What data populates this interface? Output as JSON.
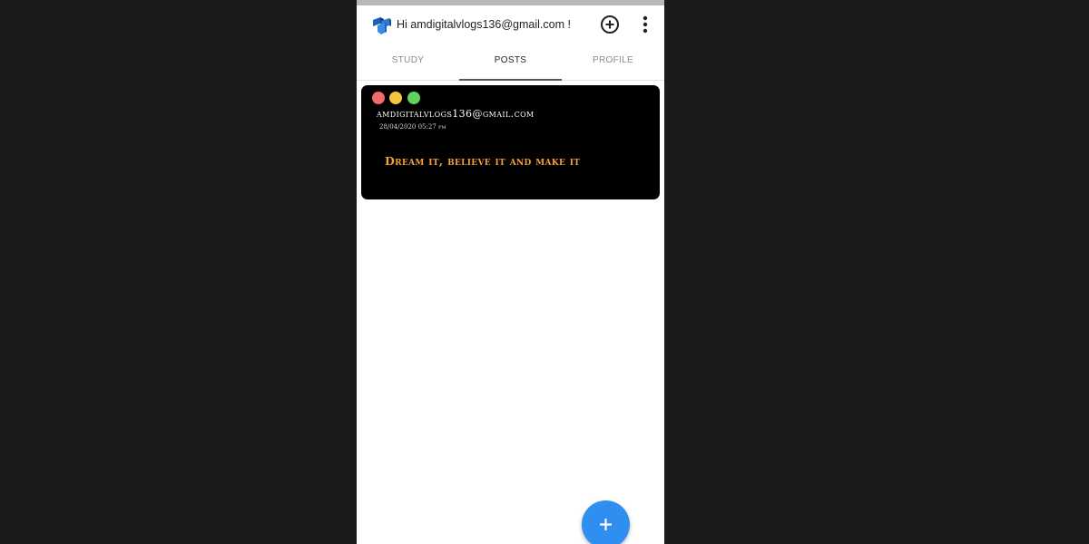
{
  "header": {
    "greeting": "Hi amdigitalvlogs136@gmail.com !"
  },
  "tabs": [
    {
      "label": "STUDY",
      "active": false
    },
    {
      "label": "POSTS",
      "active": true
    },
    {
      "label": "PROFILE",
      "active": false
    }
  ],
  "post": {
    "window_dots": [
      "#f26b6b",
      "#f3c53c",
      "#5fd35c"
    ],
    "author": "amdigitalvlogs136@gmail.com",
    "timestamp": "28/04/2020 05:27 pm",
    "text": "Dream it, believe it and make it",
    "text_color": "#f6a03a"
  },
  "icons": {
    "logo": "app-logo-icon",
    "add": "add-circle-icon",
    "menu": "more-vertical-icon",
    "fab": "plus-icon"
  },
  "colors": {
    "accent": "#2e8ff0",
    "background": "#1b1b1b"
  }
}
